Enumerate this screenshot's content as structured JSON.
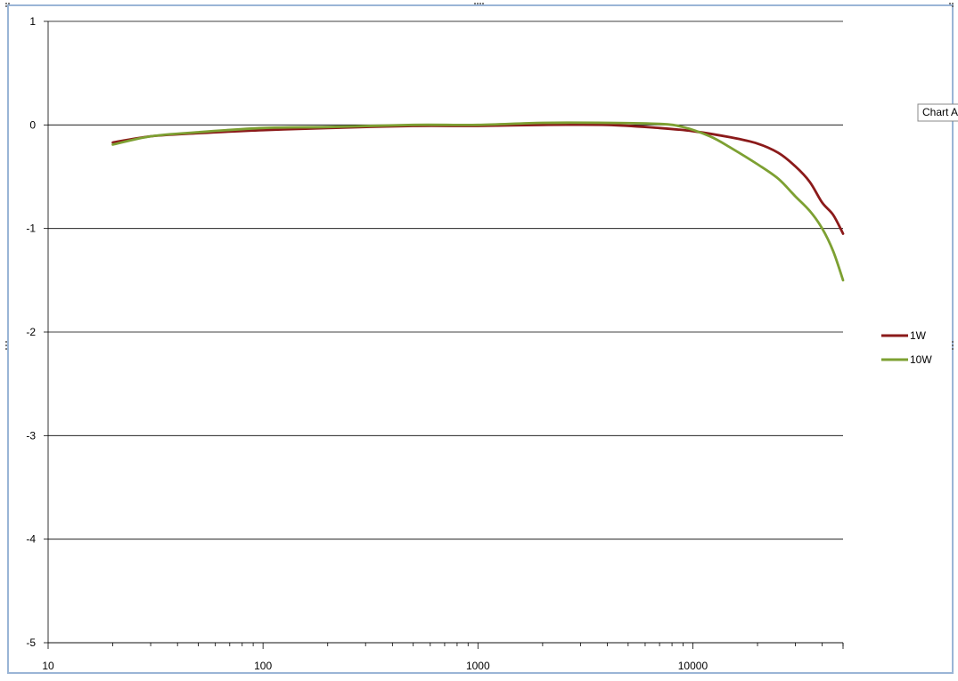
{
  "tooltip": "Chart A",
  "chart_data": {
    "type": "line",
    "x_scale": "log",
    "xlim": [
      10,
      50000
    ],
    "ylim": [
      -5,
      1
    ],
    "x_tick_labels": [
      "10",
      "100",
      "1000",
      "10000"
    ],
    "y_tick_labels": [
      "1",
      "0",
      "-1",
      "-2",
      "-3",
      "-4",
      "-5"
    ],
    "grid": "horizontal major gridlines",
    "legend": "right",
    "series": [
      {
        "name": "1W",
        "color": "#8b1a1a",
        "x": [
          20,
          30,
          50,
          100,
          200,
          500,
          1000,
          2000,
          4000,
          7000,
          10000,
          15000,
          20000,
          25000,
          30000,
          35000,
          40000,
          45000,
          50000
        ],
        "y": [
          -0.17,
          -0.11,
          -0.08,
          -0.05,
          -0.03,
          -0.01,
          -0.01,
          0.0,
          0.0,
          -0.03,
          -0.06,
          -0.12,
          -0.18,
          -0.27,
          -0.4,
          -0.55,
          -0.75,
          -0.87,
          -1.05
        ]
      },
      {
        "name": "10W",
        "color": "#7da032",
        "x": [
          20,
          30,
          50,
          100,
          200,
          500,
          1000,
          2000,
          4000,
          7000,
          9000,
          12000,
          15000,
          20000,
          25000,
          30000,
          35000,
          40000,
          45000,
          50000
        ],
        "y": [
          -0.19,
          -0.11,
          -0.07,
          -0.03,
          -0.02,
          0.0,
          0.0,
          0.02,
          0.02,
          0.01,
          -0.02,
          -0.11,
          -0.22,
          -0.38,
          -0.52,
          -0.69,
          -0.83,
          -1.0,
          -1.22,
          -1.5
        ]
      }
    ]
  }
}
